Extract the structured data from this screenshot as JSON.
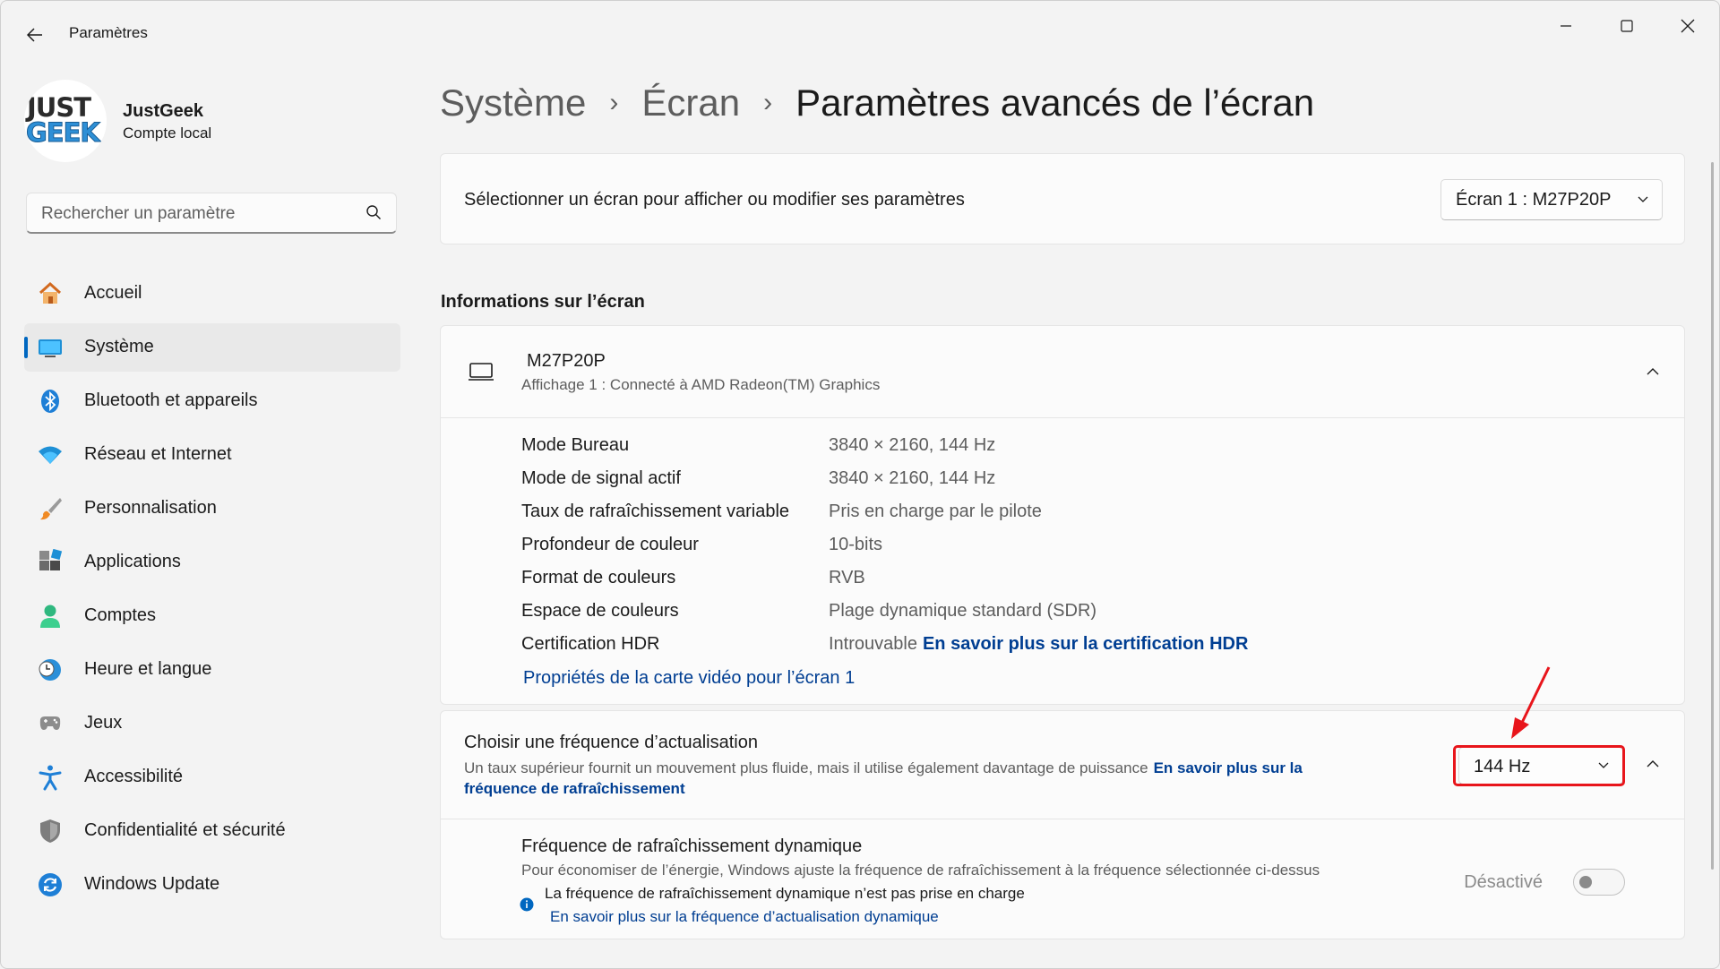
{
  "window": {
    "title": "Paramètres"
  },
  "profile": {
    "logo_top": "JUST",
    "logo_bottom": "GEEK",
    "name": "JustGeek",
    "account_type": "Compte local"
  },
  "search": {
    "placeholder": "Rechercher un paramètre"
  },
  "sidebar": {
    "items": [
      {
        "label": "Accueil",
        "icon": "home-icon"
      },
      {
        "label": "Système",
        "icon": "system-icon",
        "active": true
      },
      {
        "label": "Bluetooth et appareils",
        "icon": "bluetooth-icon"
      },
      {
        "label": "Réseau et Internet",
        "icon": "wifi-icon"
      },
      {
        "label": "Personnalisation",
        "icon": "brush-icon"
      },
      {
        "label": "Applications",
        "icon": "apps-icon"
      },
      {
        "label": "Comptes",
        "icon": "account-icon"
      },
      {
        "label": "Heure et langue",
        "icon": "clock-globe-icon"
      },
      {
        "label": "Jeux",
        "icon": "gamepad-icon"
      },
      {
        "label": "Accessibilité",
        "icon": "accessibility-icon"
      },
      {
        "label": "Confidentialité et sécurité",
        "icon": "shield-icon"
      },
      {
        "label": "Windows Update",
        "icon": "update-icon"
      }
    ]
  },
  "breadcrumb": {
    "items": [
      "Système",
      "Écran"
    ],
    "current": "Paramètres avancés de l’écran"
  },
  "display_select": {
    "label": "Sélectionner un écran pour afficher ou modifier ses paramètres",
    "value": "Écran 1 :  M27P20P"
  },
  "info_section": {
    "title": "Informations sur l’écran",
    "monitor_name": "M27P20P",
    "monitor_sub": "Affichage 1 : Connecté à AMD Radeon(TM) Graphics",
    "rows": [
      {
        "label": "Mode Bureau",
        "value": "3840 × 2160, 144 Hz"
      },
      {
        "label": "Mode de signal actif",
        "value": "3840 × 2160, 144 Hz"
      },
      {
        "label": "Taux de rafraîchissement variable",
        "value": "Pris en charge par le pilote"
      },
      {
        "label": "Profondeur de couleur",
        "value": "10-bits"
      },
      {
        "label": "Format de couleurs",
        "value": "RVB"
      },
      {
        "label": "Espace de couleurs",
        "value": "Plage dynamique standard (SDR)"
      },
      {
        "label": "Certification HDR",
        "value": "Introuvable",
        "link": "En savoir plus sur la certification HDR"
      }
    ],
    "video_link": "Propriétés de la carte vidéo pour l’écran 1"
  },
  "refresh": {
    "title": "Choisir une fréquence d’actualisation",
    "desc": "Un taux supérieur fournit un mouvement plus fluide, mais il utilise également davantage de puissance",
    "link": "En savoir plus sur la fréquence de rafraîchissement",
    "value": "144 Hz",
    "dynamic": {
      "title": "Fréquence de rafraîchissement dynamique",
      "desc": "Pour économiser de l’énergie, Windows ajuste la fréquence de rafraîchissement à la fréquence sélectionnée ci-dessus",
      "note": "La fréquence de rafraîchissement dynamique n’est pas prise en charge",
      "link": "En savoir plus sur la fréquence d’actualisation dynamique",
      "toggle_label": "Désactivé"
    }
  },
  "colors": {
    "accent": "#0067c0",
    "link": "#003e92",
    "highlight": "#e8151b"
  }
}
